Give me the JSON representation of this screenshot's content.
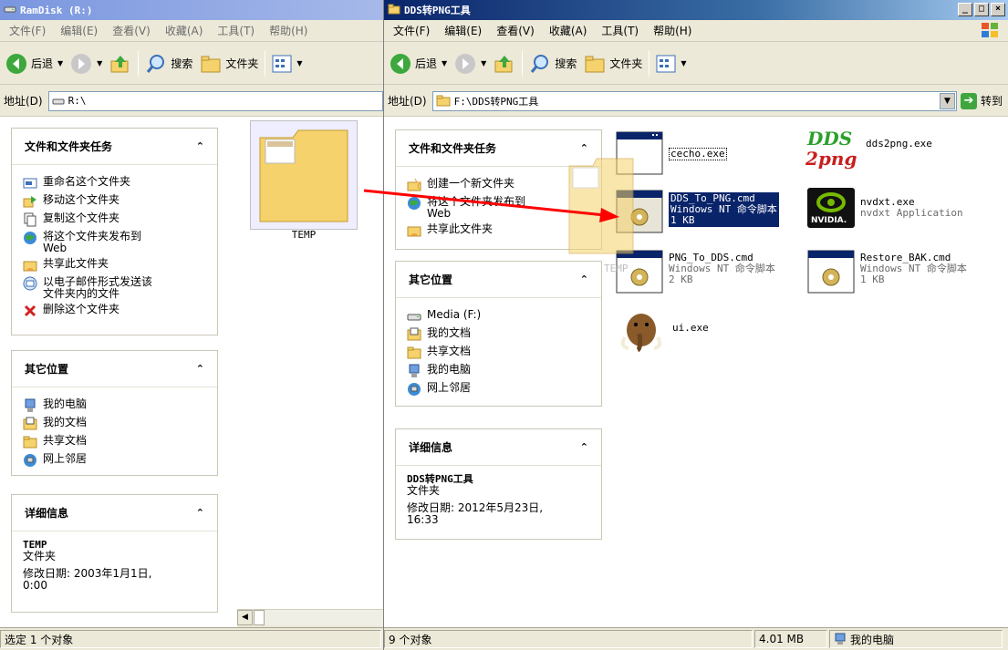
{
  "left_window": {
    "title": "RamDisk (R:)",
    "menu": [
      "文件(F)",
      "编辑(E)",
      "查看(V)",
      "收藏(A)",
      "工具(T)",
      "帮助(H)"
    ],
    "toolbar": {
      "back": "后退",
      "search": "搜索",
      "folders": "文件夹"
    },
    "address": {
      "label": "地址(D)",
      "value": "R:\\"
    },
    "tasks": {
      "title": "文件和文件夹任务",
      "items": [
        {
          "label": "重命名这个文件夹",
          "icon": "rename-icon"
        },
        {
          "label": "移动这个文件夹",
          "icon": "move-icon"
        },
        {
          "label": "复制这个文件夹",
          "icon": "copy-icon"
        },
        {
          "label": "将这个文件夹发布到\nWeb",
          "icon": "publish-web-icon"
        },
        {
          "label": "共享此文件夹",
          "icon": "share-icon"
        },
        {
          "label": "以电子邮件形式发送该\n文件夹内的文件",
          "icon": "email-icon"
        },
        {
          "label": "删除这个文件夹",
          "icon": "delete-icon"
        }
      ]
    },
    "other_places": {
      "title": "其它位置",
      "items": [
        {
          "label": "我的电脑",
          "icon": "my-computer-icon"
        },
        {
          "label": "我的文档",
          "icon": "my-documents-icon"
        },
        {
          "label": "共享文档",
          "icon": "shared-documents-icon"
        },
        {
          "label": "网上邻居",
          "icon": "network-places-icon"
        }
      ]
    },
    "details": {
      "title": "详细信息",
      "name": "TEMP",
      "type": "文件夹",
      "modified": "修改日期: 2003年1月1日,\n0:00"
    },
    "folder_item": {
      "label": "TEMP"
    },
    "status": "选定 1 个对象"
  },
  "right_window": {
    "title": "DDS转PNG工具",
    "menu": [
      "文件(F)",
      "编辑(E)",
      "查看(V)",
      "收藏(A)",
      "工具(T)",
      "帮助(H)"
    ],
    "toolbar": {
      "back": "后退",
      "search": "搜索",
      "folders": "文件夹"
    },
    "address": {
      "label": "地址(D)",
      "value": "F:\\DDS转PNG工具",
      "go": "转到"
    },
    "tasks": {
      "title": "文件和文件夹任务",
      "items": [
        {
          "label": "创建一个新文件夹",
          "icon": "new-folder-icon"
        },
        {
          "label": "将这个文件夹发布到\nWeb",
          "icon": "publish-web-icon"
        },
        {
          "label": "共享此文件夹",
          "icon": "share-icon"
        }
      ]
    },
    "other_places": {
      "title": "其它位置",
      "items": [
        {
          "label": "Media (F:)",
          "icon": "drive-icon"
        },
        {
          "label": "我的文档",
          "icon": "my-documents-icon"
        },
        {
          "label": "共享文档",
          "icon": "shared-documents-icon"
        },
        {
          "label": "我的电脑",
          "icon": "my-computer-icon"
        },
        {
          "label": "网上邻居",
          "icon": "network-places-icon"
        }
      ]
    },
    "details": {
      "title": "详细信息",
      "name": "DDS转PNG工具",
      "type": "文件夹",
      "modified": "修改日期: 2012年5月23日,\n16:33"
    },
    "files": [
      {
        "name": "cecho.exe",
        "type": "",
        "size": "",
        "icon": "exe-window-icon"
      },
      {
        "name": "dds2png.exe",
        "type": "",
        "size": "",
        "icon": "dds2png-logo-icon"
      },
      {
        "name": "DDS_To_PNG.cmd",
        "type": "Windows NT 命令脚本",
        "size": "1 KB",
        "icon": "cmd-script-icon",
        "selected": true
      },
      {
        "name": "nvdxt.exe",
        "type": "nvdxt Application",
        "size": "",
        "icon": "nvidia-icon"
      },
      {
        "name": "PNG_To_DDS.cmd",
        "type": "Windows NT 命令脚本",
        "size": "2 KB",
        "icon": "cmd-script-icon"
      },
      {
        "name": "Restore_BAK.cmd",
        "type": "Windows NT 命令脚本",
        "size": "1 KB",
        "icon": "cmd-script-icon"
      },
      {
        "name": "ui.exe",
        "type": "",
        "size": "",
        "icon": "mammoth-icon"
      }
    ],
    "nvidia_text": "NVIDIA.",
    "dds_logo": {
      "top": "DDS",
      "bottom": "2png"
    },
    "drag_ghost_label": "TEMP",
    "status": {
      "count": "9 个对象",
      "size": "4.01 MB",
      "zone": "我的电脑"
    }
  }
}
